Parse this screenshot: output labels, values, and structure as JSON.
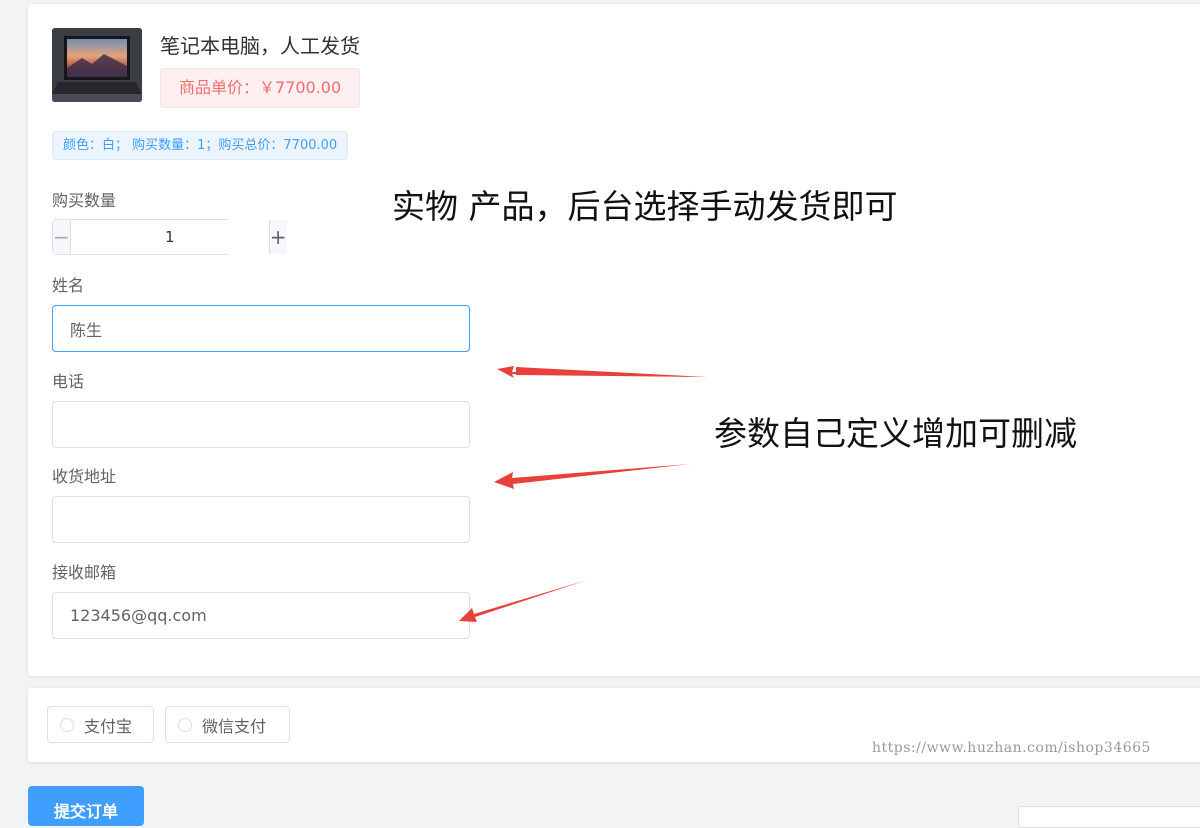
{
  "product": {
    "title": "笔记本电脑，人工发货",
    "price_label": "商品单价：￥7700.00",
    "summary": "颜色：白；  购买数量：1；购买总价：7700.00",
    "image": "laptop-product-image"
  },
  "form": {
    "quantity_label": "购买数量",
    "quantity_value": "1",
    "minus_symbol": "−",
    "plus_symbol": "+",
    "name_label": "姓名",
    "name_value": "陈生",
    "phone_label": "电话",
    "phone_value": "",
    "address_label": "收货地址",
    "address_value": "",
    "email_label": "接收邮箱",
    "email_value": "123456@qq.com"
  },
  "annotations": {
    "top_note": "实物 产品，后台选择手动发货即可",
    "side_note": "参数自己定义增加可删减"
  },
  "payment": {
    "options": [
      "支付宝",
      "微信支付"
    ]
  },
  "watermark": "https://www.huzhan.com/ishop34665",
  "actions": {
    "submit_label": "提交订单"
  },
  "colors": {
    "primary": "#409eff",
    "price_red": "#f56c6c",
    "arrow_red": "#e8403a"
  }
}
